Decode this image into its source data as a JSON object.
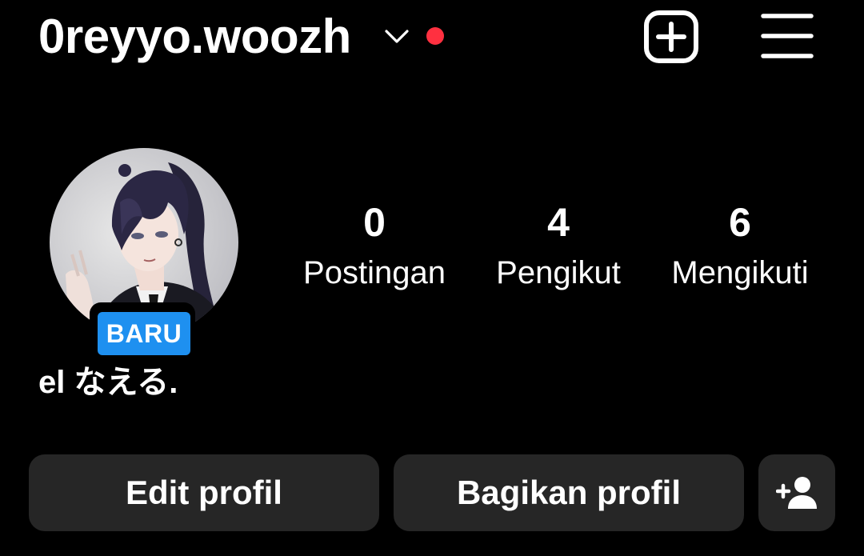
{
  "header": {
    "username": "0reyyo.woozh",
    "chevron_icon": "chevron-down-icon",
    "notification_dot_color": "#ff3040",
    "new_post_icon": "plus-square-icon",
    "menu_icon": "hamburger-menu-icon"
  },
  "profile": {
    "avatar_icon": "profile-avatar",
    "badge_label": "BARU",
    "badge_color": "#1e90f0",
    "display_name": "el なえる."
  },
  "stats": [
    {
      "count": "0",
      "label": "Postingan"
    },
    {
      "count": "4",
      "label": "Pengikut"
    },
    {
      "count": "6",
      "label": "Mengikuti"
    }
  ],
  "actions": {
    "edit_label": "Edit profil",
    "share_label": "Bagikan profil",
    "add_person_icon": "add-person-icon",
    "button_color": "#262626"
  }
}
